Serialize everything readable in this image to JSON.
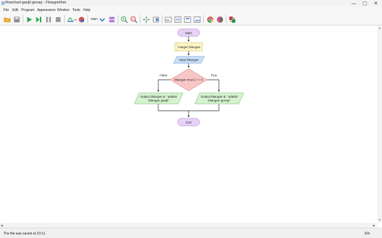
{
  "window": {
    "title": "flowchart-ganjil genap - Flowgorithm",
    "controls": {
      "minimize": "—",
      "maximize": "▢",
      "close": "✕"
    }
  },
  "menu": {
    "items": [
      "File",
      "Edit",
      "Program",
      "Appearance",
      "Window",
      "Tools",
      "Help"
    ]
  },
  "toolbar": {
    "function_select": "Main",
    "icons": [
      "open-folder-icon",
      "save-icon",
      "run-icon",
      "step-icon",
      "pause-icon",
      "stop-icon",
      "variable-watch-icon",
      "breakpoint-icon",
      "function-dropdown",
      "layout-icon",
      "zoom-in-icon",
      "zoom-out-icon",
      "add-shape-icon",
      "move-shape-icon",
      "source-code-icon",
      "console-icon",
      "debug-icon",
      "image-icon",
      "chrome-icon",
      "color-theme-icon",
      "style-icon"
    ]
  },
  "flowchart": {
    "start": "Main",
    "declare": "Integer bilangan",
    "input": "Input bilangan",
    "decision": "bilangan mod 2 == 0",
    "false_label": "False",
    "true_label": "True",
    "output_false_line1": "Output bilangan & \" adalah",
    "output_false_line2": "bilangan ganjil\"",
    "output_true_line1": "Output bilangan & \" adalah",
    "output_true_line2": "bilangan genap\"",
    "end": "End",
    "colors": {
      "terminal": "#e6d2f5",
      "declare": "#fdf6c8",
      "input": "#c9dff7",
      "decision": "#f9c6c6",
      "output": "#d5f3cf",
      "line": "#222222"
    }
  },
  "status": {
    "message": "The file was saved at 10:11.",
    "language": "EN"
  }
}
